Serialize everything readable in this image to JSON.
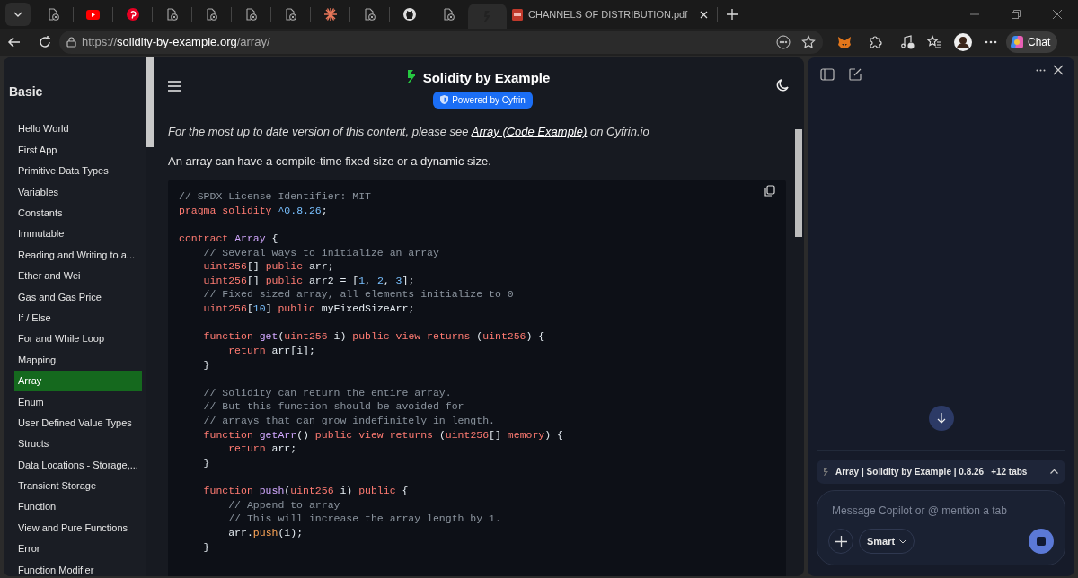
{
  "tabs": [
    {
      "kind": "page",
      "selected": false
    },
    {
      "kind": "video",
      "selected": false
    },
    {
      "kind": "pin",
      "selected": false
    },
    {
      "kind": "page",
      "selected": false
    },
    {
      "kind": "page",
      "selected": false
    },
    {
      "kind": "page",
      "selected": false
    },
    {
      "kind": "page",
      "selected": false
    },
    {
      "kind": "spark",
      "selected": false
    },
    {
      "kind": "page",
      "selected": false
    },
    {
      "kind": "git",
      "selected": false
    },
    {
      "kind": "page",
      "selected": false
    },
    {
      "kind": "site",
      "selected": true
    },
    {
      "kind": "pdf",
      "selected": false,
      "title": "CHANNELS OF DISTRIBUTION.pdf"
    }
  ],
  "address": {
    "scheme": "https://",
    "host": "solidity-by-example.org",
    "path": "/array/"
  },
  "sidebar": {
    "heading": "Basic",
    "items": [
      {
        "label": "Hello World",
        "selected": false
      },
      {
        "label": "First App",
        "selected": false
      },
      {
        "label": "Primitive Data Types",
        "selected": false
      },
      {
        "label": "Variables",
        "selected": false
      },
      {
        "label": "Constants",
        "selected": false
      },
      {
        "label": "Immutable",
        "selected": false
      },
      {
        "label": "Reading and Writing to a...",
        "selected": false
      },
      {
        "label": "Ether and Wei",
        "selected": false
      },
      {
        "label": "Gas and Gas Price",
        "selected": false
      },
      {
        "label": "If / Else",
        "selected": false
      },
      {
        "label": "For and While Loop",
        "selected": false
      },
      {
        "label": "Mapping",
        "selected": false
      },
      {
        "label": "Array",
        "selected": true
      },
      {
        "label": "Enum",
        "selected": false
      },
      {
        "label": "User Defined Value Types",
        "selected": false
      },
      {
        "label": "Structs",
        "selected": false
      },
      {
        "label": "Data Locations - Storage,...",
        "selected": false
      },
      {
        "label": "Transient Storage",
        "selected": false
      },
      {
        "label": "Function",
        "selected": false
      },
      {
        "label": "View and Pure Functions",
        "selected": false
      },
      {
        "label": "Error",
        "selected": false
      },
      {
        "label": "Function Modifier",
        "selected": false
      }
    ]
  },
  "header": {
    "title": "Solidity by Example",
    "badge": "Powered by Cyfrin"
  },
  "notice": {
    "before": "For the most up to date version of this content, please see ",
    "link": "Array (Code Example)",
    "after": " on Cyfrin.io"
  },
  "intro": "An array can have a compile-time fixed size or a dynamic size.",
  "code": [
    {
      "kind": "line",
      "tokens": [
        {
          "text": "// SPDX-License-Identifier: MIT",
          "kind": "cm"
        }
      ]
    },
    {
      "kind": "line",
      "tokens": [
        {
          "text": "pragma solidity ",
          "kind": "kw"
        },
        {
          "text": "^0.8.26",
          "kind": "num"
        },
        {
          "text": ";",
          "kind": "pl"
        }
      ]
    },
    {
      "kind": "blank"
    },
    {
      "kind": "line",
      "tokens": [
        {
          "text": "contract ",
          "kind": "kw"
        },
        {
          "text": "Array",
          "kind": "fn"
        },
        {
          "text": " {",
          "kind": "pl"
        }
      ]
    },
    {
      "kind": "line",
      "tokens": [
        {
          "text": "    // Several ways to initialize an array",
          "kind": "cm"
        }
      ]
    },
    {
      "kind": "line",
      "tokens": [
        {
          "text": "    uint256",
          "kind": "kw"
        },
        {
          "text": "[] ",
          "kind": "pl"
        },
        {
          "text": "public ",
          "kind": "kw"
        },
        {
          "text": "arr;",
          "kind": "pl"
        }
      ]
    },
    {
      "kind": "line",
      "tokens": [
        {
          "text": "    uint256",
          "kind": "kw"
        },
        {
          "text": "[] ",
          "kind": "pl"
        },
        {
          "text": "public ",
          "kind": "kw"
        },
        {
          "text": "arr2 = [",
          "kind": "pl"
        },
        {
          "text": "1",
          "kind": "num"
        },
        {
          "text": ", ",
          "kind": "pl"
        },
        {
          "text": "2",
          "kind": "num"
        },
        {
          "text": ", ",
          "kind": "pl"
        },
        {
          "text": "3",
          "kind": "num"
        },
        {
          "text": "];",
          "kind": "pl"
        }
      ]
    },
    {
      "kind": "line",
      "tokens": [
        {
          "text": "    // Fixed sized array, all elements initialize to 0",
          "kind": "cm"
        }
      ]
    },
    {
      "kind": "line",
      "tokens": [
        {
          "text": "    uint256",
          "kind": "kw"
        },
        {
          "text": "[",
          "kind": "pl"
        },
        {
          "text": "10",
          "kind": "num"
        },
        {
          "text": "] ",
          "kind": "pl"
        },
        {
          "text": "public ",
          "kind": "kw"
        },
        {
          "text": "myFixedSizeArr;",
          "kind": "pl"
        }
      ]
    },
    {
      "kind": "blank"
    },
    {
      "kind": "line",
      "tokens": [
        {
          "text": "    function ",
          "kind": "kw"
        },
        {
          "text": "get",
          "kind": "fn"
        },
        {
          "text": "(",
          "kind": "pl"
        },
        {
          "text": "uint256",
          "kind": "kw"
        },
        {
          "text": " i) ",
          "kind": "pl"
        },
        {
          "text": "public view returns ",
          "kind": "kw"
        },
        {
          "text": "(",
          "kind": "pl"
        },
        {
          "text": "uint256",
          "kind": "kw"
        },
        {
          "text": ") {",
          "kind": "pl"
        }
      ]
    },
    {
      "kind": "line",
      "tokens": [
        {
          "text": "        return ",
          "kind": "kw"
        },
        {
          "text": "arr[i];",
          "kind": "pl"
        }
      ]
    },
    {
      "kind": "line",
      "tokens": [
        {
          "text": "    }",
          "kind": "pl"
        }
      ]
    },
    {
      "kind": "blank"
    },
    {
      "kind": "line",
      "tokens": [
        {
          "text": "    // Solidity can return the entire array.",
          "kind": "cm"
        }
      ]
    },
    {
      "kind": "line",
      "tokens": [
        {
          "text": "    // But this function should be avoided for",
          "kind": "cm"
        }
      ]
    },
    {
      "kind": "line",
      "tokens": [
        {
          "text": "    // arrays that can grow indefinitely in length.",
          "kind": "cm"
        }
      ]
    },
    {
      "kind": "line",
      "tokens": [
        {
          "text": "    function ",
          "kind": "kw"
        },
        {
          "text": "getArr",
          "kind": "fn"
        },
        {
          "text": "() ",
          "kind": "pl"
        },
        {
          "text": "public view returns ",
          "kind": "kw"
        },
        {
          "text": "(",
          "kind": "pl"
        },
        {
          "text": "uint256",
          "kind": "kw"
        },
        {
          "text": "[] ",
          "kind": "pl"
        },
        {
          "text": "memory",
          "kind": "kw"
        },
        {
          "text": ") {",
          "kind": "pl"
        }
      ]
    },
    {
      "kind": "line",
      "tokens": [
        {
          "text": "        return ",
          "kind": "kw"
        },
        {
          "text": "arr;",
          "kind": "pl"
        }
      ]
    },
    {
      "kind": "line",
      "tokens": [
        {
          "text": "    }",
          "kind": "pl"
        }
      ]
    },
    {
      "kind": "blank"
    },
    {
      "kind": "line",
      "tokens": [
        {
          "text": "    function ",
          "kind": "kw"
        },
        {
          "text": "push",
          "kind": "fn"
        },
        {
          "text": "(",
          "kind": "pl"
        },
        {
          "text": "uint256",
          "kind": "kw"
        },
        {
          "text": " i) ",
          "kind": "pl"
        },
        {
          "text": "public ",
          "kind": "kw"
        },
        {
          "text": "{",
          "kind": "pl"
        }
      ]
    },
    {
      "kind": "line",
      "tokens": [
        {
          "text": "        // Append to array",
          "kind": "cm"
        }
      ]
    },
    {
      "kind": "line",
      "tokens": [
        {
          "text": "        // This will increase the array length by 1.",
          "kind": "cm"
        }
      ]
    },
    {
      "kind": "line",
      "tokens": [
        {
          "text": "        arr.",
          "kind": "pl"
        },
        {
          "text": "push",
          "kind": "or"
        },
        {
          "text": "(i);",
          "kind": "pl"
        }
      ]
    },
    {
      "kind": "line",
      "tokens": [
        {
          "text": "    }",
          "kind": "pl"
        }
      ]
    }
  ],
  "copilot": {
    "context": "Array | Solidity by Example | 0.8.26",
    "context_extra": "+12 tabs",
    "placeholder": "Message Copilot or @ mention a tab",
    "mode": "Smart"
  },
  "toolbar": {
    "chat": "Chat"
  }
}
